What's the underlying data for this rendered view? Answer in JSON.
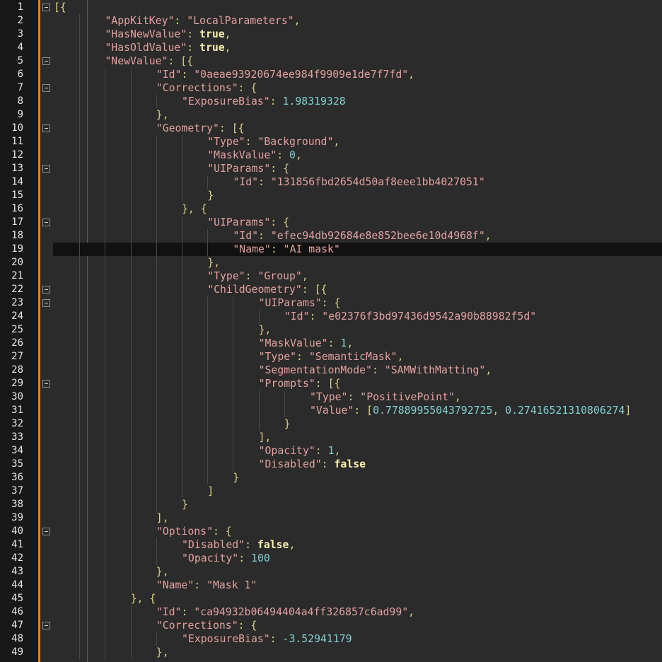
{
  "lines": [
    {
      "n": "1",
      "indent": 0,
      "fold": true,
      "t": [
        [
          "p",
          "[{"
        ]
      ]
    },
    {
      "n": "2",
      "indent": 2,
      "t": [
        [
          "k",
          "\"AppKitKey\""
        ],
        [
          "p",
          ": "
        ],
        [
          "s",
          "\"LocalParameters\""
        ],
        [
          "p",
          ","
        ]
      ]
    },
    {
      "n": "3",
      "indent": 2,
      "t": [
        [
          "k",
          "\"HasNewValue\""
        ],
        [
          "p",
          ": "
        ],
        [
          "b",
          "true"
        ],
        [
          "p",
          ","
        ]
      ]
    },
    {
      "n": "4",
      "indent": 2,
      "t": [
        [
          "k",
          "\"HasOldValue\""
        ],
        [
          "p",
          ": "
        ],
        [
          "b",
          "true"
        ],
        [
          "p",
          ","
        ]
      ]
    },
    {
      "n": "5",
      "indent": 2,
      "fold": true,
      "t": [
        [
          "k",
          "\"NewValue\""
        ],
        [
          "p",
          ": [{"
        ]
      ]
    },
    {
      "n": "6",
      "indent": 4,
      "t": [
        [
          "k",
          "\"Id\""
        ],
        [
          "p",
          ": "
        ],
        [
          "s",
          "\"0aeae93920674ee984f9909e1de7f7fd\""
        ],
        [
          "p",
          ","
        ]
      ]
    },
    {
      "n": "7",
      "indent": 4,
      "fold": true,
      "t": [
        [
          "k",
          "\"Corrections\""
        ],
        [
          "p",
          ": {"
        ]
      ]
    },
    {
      "n": "8",
      "indent": 5,
      "t": [
        [
          "k",
          "\"ExposureBias\""
        ],
        [
          "p",
          ": "
        ],
        [
          "n",
          "1.98319328"
        ]
      ]
    },
    {
      "n": "9",
      "indent": 4,
      "t": [
        [
          "p",
          "},"
        ]
      ]
    },
    {
      "n": "10",
      "indent": 4,
      "fold": true,
      "t": [
        [
          "k",
          "\"Geometry\""
        ],
        [
          "p",
          ": [{"
        ]
      ]
    },
    {
      "n": "11",
      "indent": 6,
      "t": [
        [
          "k",
          "\"Type\""
        ],
        [
          "p",
          ": "
        ],
        [
          "s",
          "\"Background\""
        ],
        [
          "p",
          ","
        ]
      ]
    },
    {
      "n": "12",
      "indent": 6,
      "t": [
        [
          "k",
          "\"MaskValue\""
        ],
        [
          "p",
          ": "
        ],
        [
          "n",
          "0"
        ],
        [
          "p",
          ","
        ]
      ]
    },
    {
      "n": "13",
      "indent": 6,
      "fold": true,
      "t": [
        [
          "k",
          "\"UIParams\""
        ],
        [
          "p",
          ": {"
        ]
      ]
    },
    {
      "n": "14",
      "indent": 7,
      "t": [
        [
          "k",
          "\"Id\""
        ],
        [
          "p",
          ": "
        ],
        [
          "s",
          "\"131856fbd2654d50af8eee1bb4027051\""
        ]
      ]
    },
    {
      "n": "15",
      "indent": 6,
      "t": [
        [
          "p",
          "}"
        ]
      ]
    },
    {
      "n": "16",
      "indent": 5,
      "t": [
        [
          "p",
          "}, {"
        ]
      ]
    },
    {
      "n": "17",
      "indent": 6,
      "fold": true,
      "t": [
        [
          "k",
          "\"UIParams\""
        ],
        [
          "p",
          ": {"
        ]
      ]
    },
    {
      "n": "18",
      "indent": 7,
      "t": [
        [
          "k",
          "\"Id\""
        ],
        [
          "p",
          ": "
        ],
        [
          "s",
          "\"efec94db92684e8e852bee6e10d4968f\""
        ],
        [
          "p",
          ","
        ]
      ]
    },
    {
      "n": "19",
      "indent": 7,
      "current": true,
      "t": [
        [
          "k",
          "\"Name\""
        ],
        [
          "p",
          ": "
        ],
        [
          "s",
          "\"AI mask\""
        ]
      ]
    },
    {
      "n": "20",
      "indent": 6,
      "t": [
        [
          "p",
          "},"
        ]
      ]
    },
    {
      "n": "21",
      "indent": 6,
      "t": [
        [
          "k",
          "\"Type\""
        ],
        [
          "p",
          ": "
        ],
        [
          "s",
          "\"Group\""
        ],
        [
          "p",
          ","
        ]
      ]
    },
    {
      "n": "22",
      "indent": 6,
      "fold": true,
      "t": [
        [
          "k",
          "\"ChildGeometry\""
        ],
        [
          "p",
          ": [{"
        ]
      ]
    },
    {
      "n": "23",
      "indent": 8,
      "fold": true,
      "t": [
        [
          "k",
          "\"UIParams\""
        ],
        [
          "p",
          ": {"
        ]
      ]
    },
    {
      "n": "24",
      "indent": 9,
      "t": [
        [
          "k",
          "\"Id\""
        ],
        [
          "p",
          ": "
        ],
        [
          "s",
          "\"e02376f3bd97436d9542a90b88982f5d\""
        ]
      ]
    },
    {
      "n": "25",
      "indent": 8,
      "t": [
        [
          "p",
          "},"
        ]
      ]
    },
    {
      "n": "26",
      "indent": 8,
      "t": [
        [
          "k",
          "\"MaskValue\""
        ],
        [
          "p",
          ": "
        ],
        [
          "n",
          "1"
        ],
        [
          "p",
          ","
        ]
      ]
    },
    {
      "n": "27",
      "indent": 8,
      "t": [
        [
          "k",
          "\"Type\""
        ],
        [
          "p",
          ": "
        ],
        [
          "s",
          "\"SemanticMask\""
        ],
        [
          "p",
          ","
        ]
      ]
    },
    {
      "n": "28",
      "indent": 8,
      "t": [
        [
          "k",
          "\"SegmentationMode\""
        ],
        [
          "p",
          ": "
        ],
        [
          "s",
          "\"SAMWithMatting\""
        ],
        [
          "p",
          ","
        ]
      ]
    },
    {
      "n": "29",
      "indent": 8,
      "fold": true,
      "t": [
        [
          "k",
          "\"Prompts\""
        ],
        [
          "p",
          ": [{"
        ]
      ]
    },
    {
      "n": "30",
      "indent": 10,
      "t": [
        [
          "k",
          "\"Type\""
        ],
        [
          "p",
          ": "
        ],
        [
          "s",
          "\"PositivePoint\""
        ],
        [
          "p",
          ","
        ]
      ]
    },
    {
      "n": "31",
      "indent": 10,
      "t": [
        [
          "k",
          "\"Value\""
        ],
        [
          "p",
          ": ["
        ],
        [
          "n",
          "0.77889955043792725"
        ],
        [
          "p",
          ", "
        ],
        [
          "n",
          "0.27416521310806274"
        ],
        [
          "p",
          "]"
        ]
      ]
    },
    {
      "n": "32",
      "indent": 9,
      "t": [
        [
          "p",
          "}"
        ]
      ]
    },
    {
      "n": "33",
      "indent": 8,
      "t": [
        [
          "p",
          "],"
        ]
      ]
    },
    {
      "n": "34",
      "indent": 8,
      "t": [
        [
          "k",
          "\"Opacity\""
        ],
        [
          "p",
          ": "
        ],
        [
          "n",
          "1"
        ],
        [
          "p",
          ","
        ]
      ]
    },
    {
      "n": "35",
      "indent": 8,
      "t": [
        [
          "k",
          "\"Disabled\""
        ],
        [
          "p",
          ": "
        ],
        [
          "b",
          "false"
        ]
      ]
    },
    {
      "n": "36",
      "indent": 7,
      "t": [
        [
          "p",
          "}"
        ]
      ]
    },
    {
      "n": "37",
      "indent": 6,
      "t": [
        [
          "p",
          "]"
        ]
      ]
    },
    {
      "n": "38",
      "indent": 5,
      "t": [
        [
          "p",
          "}"
        ]
      ]
    },
    {
      "n": "39",
      "indent": 4,
      "t": [
        [
          "p",
          "],"
        ]
      ]
    },
    {
      "n": "40",
      "indent": 4,
      "fold": true,
      "t": [
        [
          "k",
          "\"Options\""
        ],
        [
          "p",
          ": {"
        ]
      ]
    },
    {
      "n": "41",
      "indent": 5,
      "t": [
        [
          "k",
          "\"Disabled\""
        ],
        [
          "p",
          ": "
        ],
        [
          "b",
          "false"
        ],
        [
          "p",
          ","
        ]
      ]
    },
    {
      "n": "42",
      "indent": 5,
      "t": [
        [
          "k",
          "\"Opacity\""
        ],
        [
          "p",
          ": "
        ],
        [
          "n",
          "100"
        ]
      ]
    },
    {
      "n": "43",
      "indent": 4,
      "t": [
        [
          "p",
          "},"
        ]
      ]
    },
    {
      "n": "44",
      "indent": 4,
      "t": [
        [
          "k",
          "\"Name\""
        ],
        [
          "p",
          ": "
        ],
        [
          "s",
          "\"Mask 1\""
        ]
      ]
    },
    {
      "n": "45",
      "indent": 3,
      "t": [
        [
          "p",
          "}, {"
        ]
      ]
    },
    {
      "n": "46",
      "indent": 4,
      "t": [
        [
          "k",
          "\"Id\""
        ],
        [
          "p",
          ": "
        ],
        [
          "s",
          "\"ca94932b06494404a4ff326857c6ad99\""
        ],
        [
          "p",
          ","
        ]
      ]
    },
    {
      "n": "47",
      "indent": 4,
      "fold": true,
      "t": [
        [
          "k",
          "\"Corrections\""
        ],
        [
          "p",
          ": {"
        ]
      ]
    },
    {
      "n": "48",
      "indent": 5,
      "t": [
        [
          "k",
          "\"ExposureBias\""
        ],
        [
          "p",
          ": "
        ],
        [
          "n",
          "-3.52941179"
        ]
      ]
    },
    {
      "n": "49",
      "indent": 4,
      "t": [
        [
          "p",
          "},"
        ]
      ]
    }
  ],
  "colors": {
    "background": "#2b2b2b",
    "gutter": "#181818",
    "gutter_edge": "#f07818",
    "current_line": "#111111",
    "line_number": "#e6e6e6",
    "key": "#e2a0a0",
    "string": "#e2a0a0",
    "punctuation": "#d8d080",
    "number": "#80d0d0",
    "boolean": "#f6f0b0",
    "indent_guide": "#484848"
  }
}
